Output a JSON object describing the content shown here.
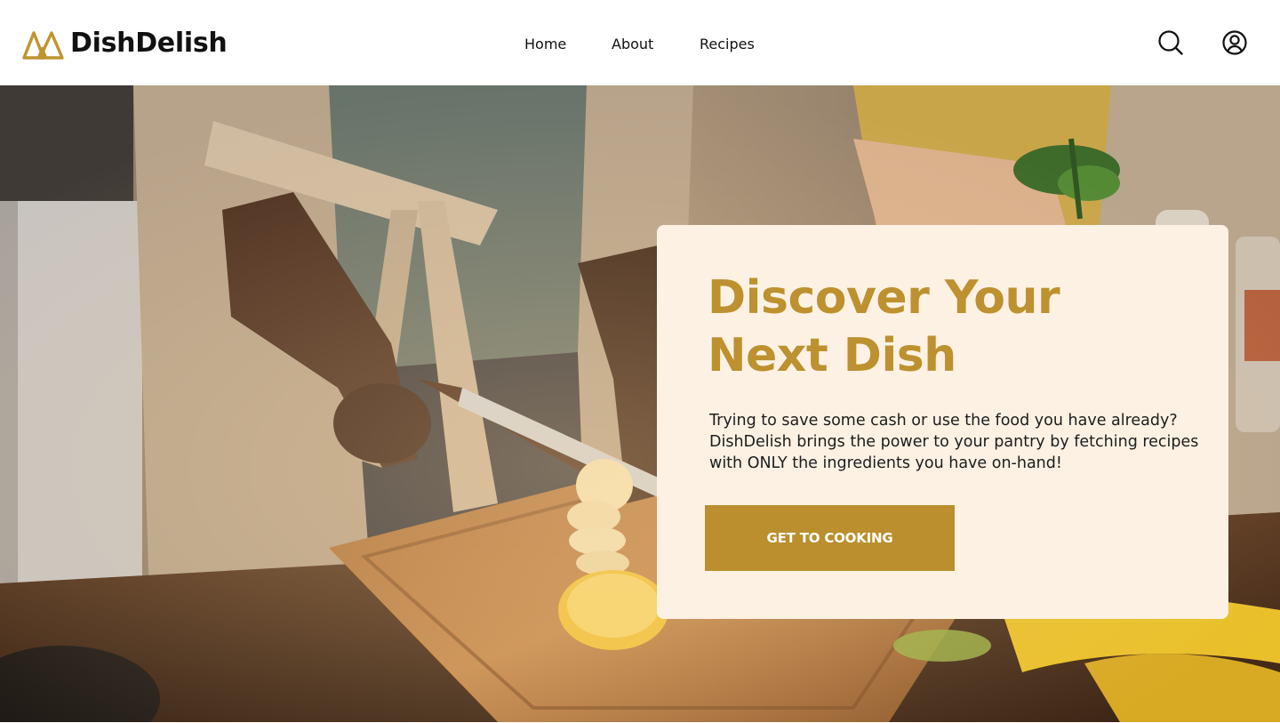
{
  "brand": {
    "name": "DishDelish",
    "logo_icon": "mountain-logo-icon",
    "accent_color": "#bd912f"
  },
  "nav": {
    "items": [
      {
        "label": "Home"
      },
      {
        "label": "About"
      },
      {
        "label": "Recipes"
      }
    ]
  },
  "header_icons": {
    "search": "search-icon",
    "account": "user-circle-icon"
  },
  "hero": {
    "background_image": "people-cutting-banana-in-kitchen-photo",
    "title_line1": "Discover Your",
    "title_line2": "Next Dish",
    "description": "Trying to save some cash or use the food you have already? DishDelish brings the power to your pantry by fetching recipes with ONLY the ingredients you have on-hand!",
    "cta_label": "GET TO COOKING",
    "card_color": "#fdf1e3",
    "button_color": "#bb8f2d"
  }
}
